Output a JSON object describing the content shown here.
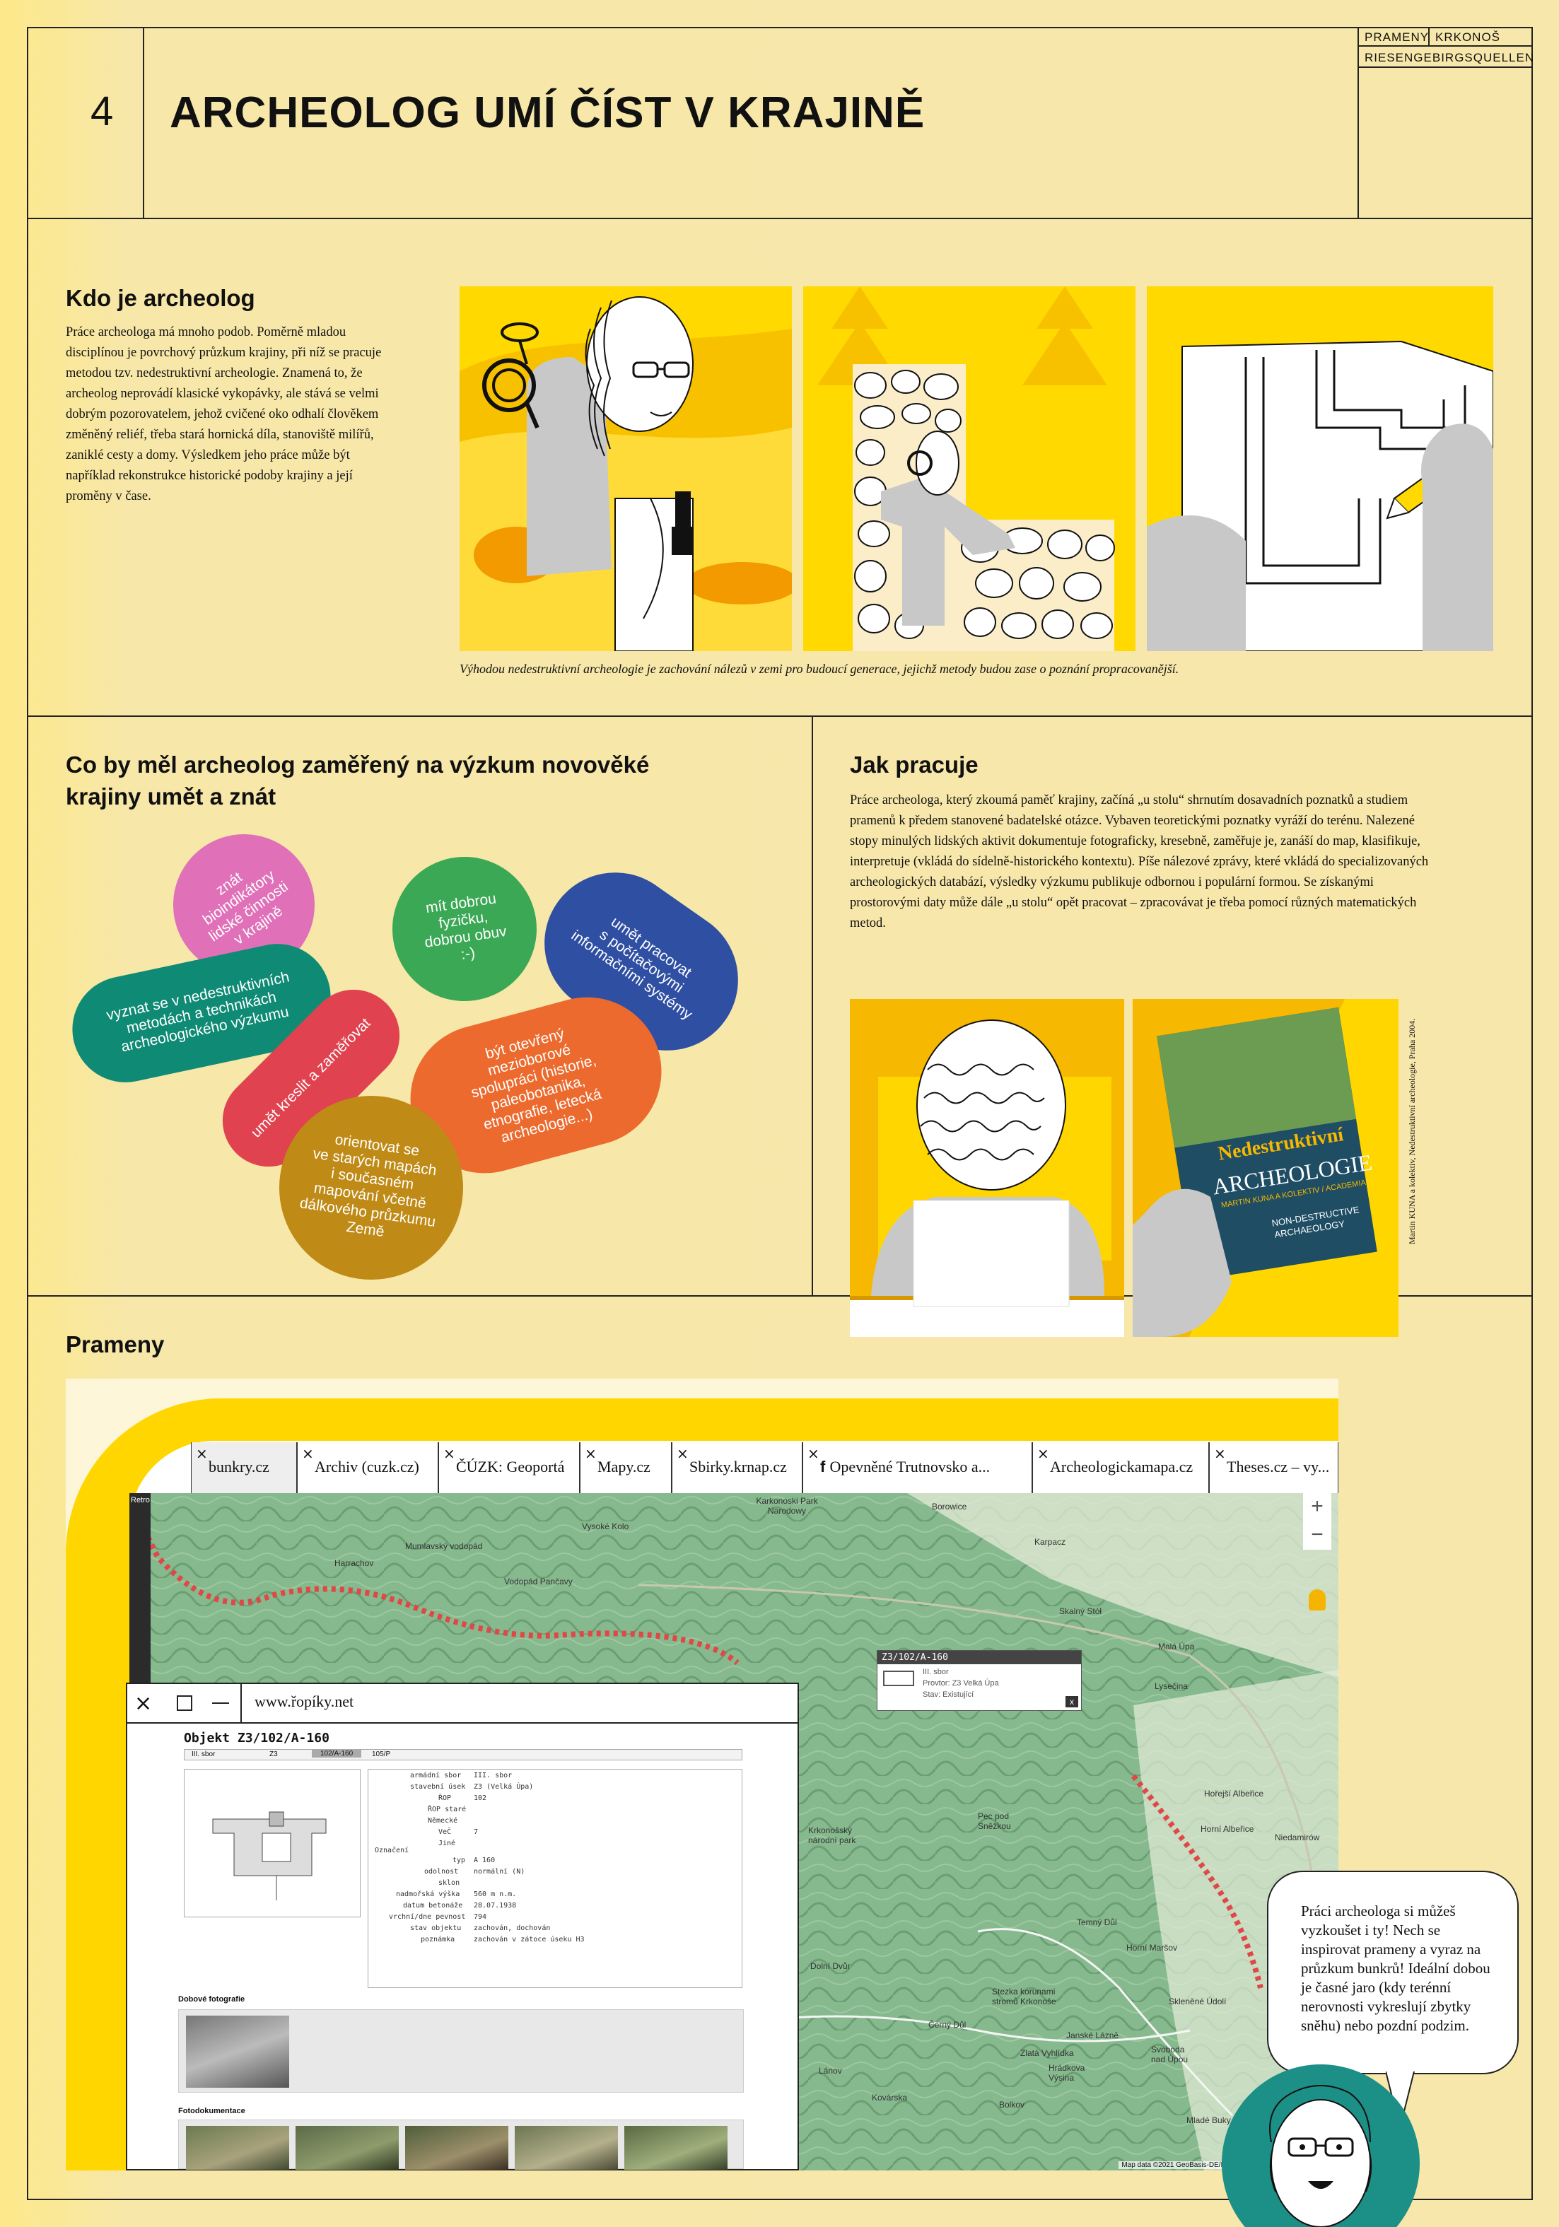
{
  "header": {
    "page_number": "4",
    "title": "ARCHEOLOG UMÍ ČÍST V KRAJINĚ",
    "brand_line1_a": "PRAMENY",
    "brand_line1_b": "KRKONOŠ",
    "brand_line2": "RIESENGEBIRGSQUELLEN"
  },
  "section1": {
    "heading": "Kdo je archeolog",
    "body": "Práce archeologa má mnoho podob. Poměrně mladou disciplínou je povrchový průzkum krajiny, při níž se pracuje metodou tzv. nedestruktivní archeologie. Znamená to, že archeolog neprovádí klasické vykopávky, ale stává se velmi dobrým pozorovatelem, jehož cvičené oko odhalí člověkem změněný reliéf, třeba stará hornická díla, stanoviště milířů, zaniklé cesty a domy. Výsledkem jeho práce může být například rekonstrukce historické podoby krajiny a její proměny v čase.",
    "caption": "Výhodou nedestruktivní archeologie je zachování nálezů v zemi pro budoucí generace, jejichž metody budou zase o poznání propracovanější."
  },
  "section2": {
    "heading": "Co by měl archeolog zaměřený na výzkum novověké krajiny umět a znát",
    "bubbles": [
      {
        "text": "znát\nbioindikátory\nlidské činnosti\nv krajině",
        "color": "#e070b8"
      },
      {
        "text": "mít dobrou\nfyzičku,\ndobrou obuv\n:-)",
        "color": "#3aa854"
      },
      {
        "text": "umět pracovat\ns počítačovými\ninformačními systémy",
        "color": "#2f4fa3"
      },
      {
        "text": "vyznat se v nedestruktivních\nmetodách a technikách\narcheologického výzkumu",
        "color": "#0f8a74"
      },
      {
        "text": "umět kreslit a zaměřovat",
        "color": "#e0424f"
      },
      {
        "text": "být otevřený\nmezioborové\nspolupráci (historie,\npaleobotanika,\netnografie, letecká\narcheologie...)",
        "color": "#ec6a2e"
      },
      {
        "text": "orientovat se\nve starých mapách\ni současném\nmapování včetně\ndálkového průzkumu\nZemě",
        "color": "#bf8a16"
      }
    ]
  },
  "section3": {
    "heading": "Jak pracuje",
    "body": "Práce archeologa, který zkoumá paměť krajiny, začíná „u stolu“ shrnutím dosavadních poznatků a studiem pramenů k předem stanovené badatelské otázce. Vybaven teoretickými poznatky vyráží do terénu. Nalezené stopy minulých lidských aktivit dokumentuje fotograficky, kresebně, zaměřuje je, zanáší do map, klasifikuje, interpretuje (vkládá do sídelně-historického kontextu). Píše nálezové zprávy, které vkládá do specializovaných archeologických databází, výsledky výzkumu publikuje odbornou i populární formou. Se získanými prostorovými daty může dále „u stolu“ opět pracovat – zpracovávat je třeba pomocí různých matematických metod.",
    "book": {
      "title_line1": "Nedestruktivní",
      "title_line2": "ARCHEOLOGIE",
      "authors": "MARTIN KUNA A KOLEKTIV / ACADEMIA",
      "subtitle_line1": "NON-DESTRUCTIVE",
      "subtitle_line2": "ARCHAEOLOGY"
    },
    "side_caption": "Martin KUNA a kolektiv, Nedestruktivní archeologie, Praha 2004."
  },
  "section4": {
    "heading": "Prameny",
    "tabs": [
      "bunkry.cz",
      "Archiv (cuzk.cz)",
      "ČÚZK: Geoportá",
      "Mapy.cz",
      "Sbirky.krnap.cz",
      "Opevněné Trutnovsko a...",
      "Archeologickamapa.cz",
      "Theses.cz – vy..."
    ],
    "popup_url": "www.řopíky.net",
    "object_title": "Objekt Z3/102/A-160",
    "object_tabs": [
      "III. sbor",
      "Z3",
      "102/A-160",
      "105/P"
    ],
    "object_rows": [
      [
        "armádní sbor",
        "III. sbor"
      ],
      [
        "stavební úsek",
        "Z3 (Velká Úpa)"
      ],
      [
        "ŘOP",
        "102"
      ],
      [
        "ŘOP staré",
        ""
      ],
      [
        "Německé",
        ""
      ],
      [
        "VeČ",
        "7"
      ],
      [
        "Jiné",
        ""
      ],
      [
        "typ",
        "A 160"
      ],
      [
        "odolnost",
        "normální (N)"
      ],
      [
        "sklon",
        ""
      ],
      [
        "nadmořská výška",
        "560 m n.m."
      ],
      [
        "datum betonáže",
        "28.07.1938"
      ],
      [
        "vrchní/dne pevnost",
        "794"
      ],
      [
        "stav objektu",
        "zachován, dochován"
      ],
      [
        "poznámka",
        "zachován v zátoce úseku H3"
      ]
    ],
    "object_group_label": "Označení",
    "photo_section1": "Dobové fotografie",
    "photo_section2": "Fotodokumentace",
    "map_popup": {
      "title": "Z3/102/A-160",
      "line1": "III. sbor",
      "line2": "Provtor: Z3 Velká Úpa",
      "line3": "Stav: Existující"
    },
    "map_labels": [
      "Karkonoski Park Narodowy",
      "Borowice",
      "Harrachov",
      "Mumlavský vodopád",
      "Vysoké Kolo",
      "Vodopád Pančavy",
      "Karpacz",
      "Skalný Stół",
      "Malá Úpa",
      "Lysečina",
      "Krkonošský národní park",
      "Pec pod Sněžkou",
      "Horní Albeřice",
      "Niedamirów",
      "Temný Důl",
      "Horní Maršov",
      "Dolní Dvůr",
      "Stezka korunami stromů Krkonoše",
      "Černý Důl",
      "Zlatá Vyhlídka",
      "Hrádkova Výsina",
      "Svoboda nad Úpou",
      "Janské Lázně",
      "Lánov",
      "Kovárska",
      "Bolkov",
      "Mladé Buky",
      "Retro",
      "Skleněné Údolí",
      "Hořejší Albeřice"
    ],
    "map_attribution": "Map data ©2021 GeoBasis-DE/BKG (©2009), Google   1 km",
    "speech": "Práci archeologa si můžeš vyzkoušet i ty! Nech se inspirovat prameny a vyraz na průzkum bunkrů! Ideální dobou je časné jaro (kdy terénní nerovnosti vykreslují zbytky sněhu) nebo pozdní podzim."
  },
  "colors": {
    "background": "#f7e7ab",
    "yellow": "#ffd600",
    "orange": "#f6b800",
    "gray": "#c8c8c8",
    "map_green": "#7fb58a",
    "teal": "#1c8f86"
  }
}
